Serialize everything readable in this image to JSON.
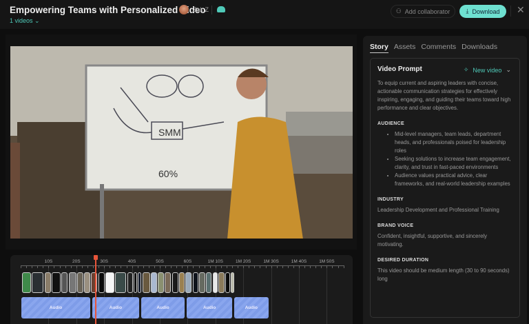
{
  "header": {
    "title": "Empowering Teams with Personalized Video",
    "user": "Zak Z",
    "videos_label": "1 videos",
    "add_collaborator": "Add collaborator",
    "download": "Download"
  },
  "timeline": {
    "ticks": [
      "10S",
      "20S",
      "30S",
      "40S",
      "50S",
      "60S",
      "1M 10S",
      "1M 20S",
      "1M 30S",
      "1M 40S",
      "1M 50S"
    ],
    "playhead_seconds": 27,
    "audio_label": "Audio",
    "audio_segments": [
      [
        0,
        25
      ],
      [
        25.5,
        42.5
      ],
      [
        43,
        59
      ],
      [
        59.5,
        76
      ],
      [
        76.5,
        89
      ]
    ]
  },
  "panel": {
    "tabs": [
      "Story",
      "Assets",
      "Comments",
      "Downloads"
    ],
    "active_tab": "Story",
    "card_title": "Video Prompt",
    "new_video": "New video",
    "prompt": "To equip current and aspiring leaders with concise, actionable communication strategies for effectively inspiring, engaging, and guiding their teams toward high performance and clear objectives.",
    "audience_heading": "AUDIENCE",
    "audience": [
      "Mid-level managers, team leads, department heads, and professionals poised for leadership roles",
      "Seeking solutions to increase team engagement, clarity, and trust in fast-paced environments",
      "Audience values practical advice, clear frameworks, and real-world leadership examples"
    ],
    "industry_heading": "INDUSTRY",
    "industry": "Leadership Development and Professional Training",
    "brand_heading": "BRAND VOICE",
    "brand": "Confident, insightful, supportive, and sincerely motivating.",
    "duration_heading": "DESIRED DURATION",
    "duration": "This video should be medium length (30 to 90 seconds) long"
  },
  "colors": {
    "accent": "#4fc9b8",
    "playhead": "#e8553a",
    "audio": "#8aa6ee"
  }
}
